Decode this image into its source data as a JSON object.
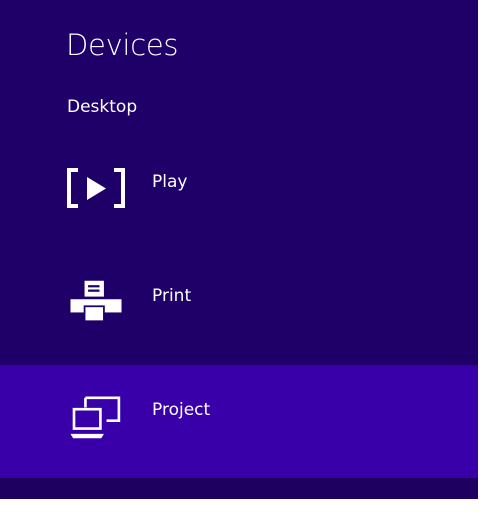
{
  "charm": {
    "title": "Devices",
    "subtitle": "Desktop",
    "items": [
      {
        "label": "Play",
        "icon": "play-to-icon",
        "selected": false
      },
      {
        "label": "Print",
        "icon": "printer-icon",
        "selected": false
      },
      {
        "label": "Project",
        "icon": "project-screens-icon",
        "selected": true
      }
    ]
  },
  "colors": {
    "background": "#1f0068",
    "selected_background": "#3900a9",
    "text": "#ffffff"
  }
}
